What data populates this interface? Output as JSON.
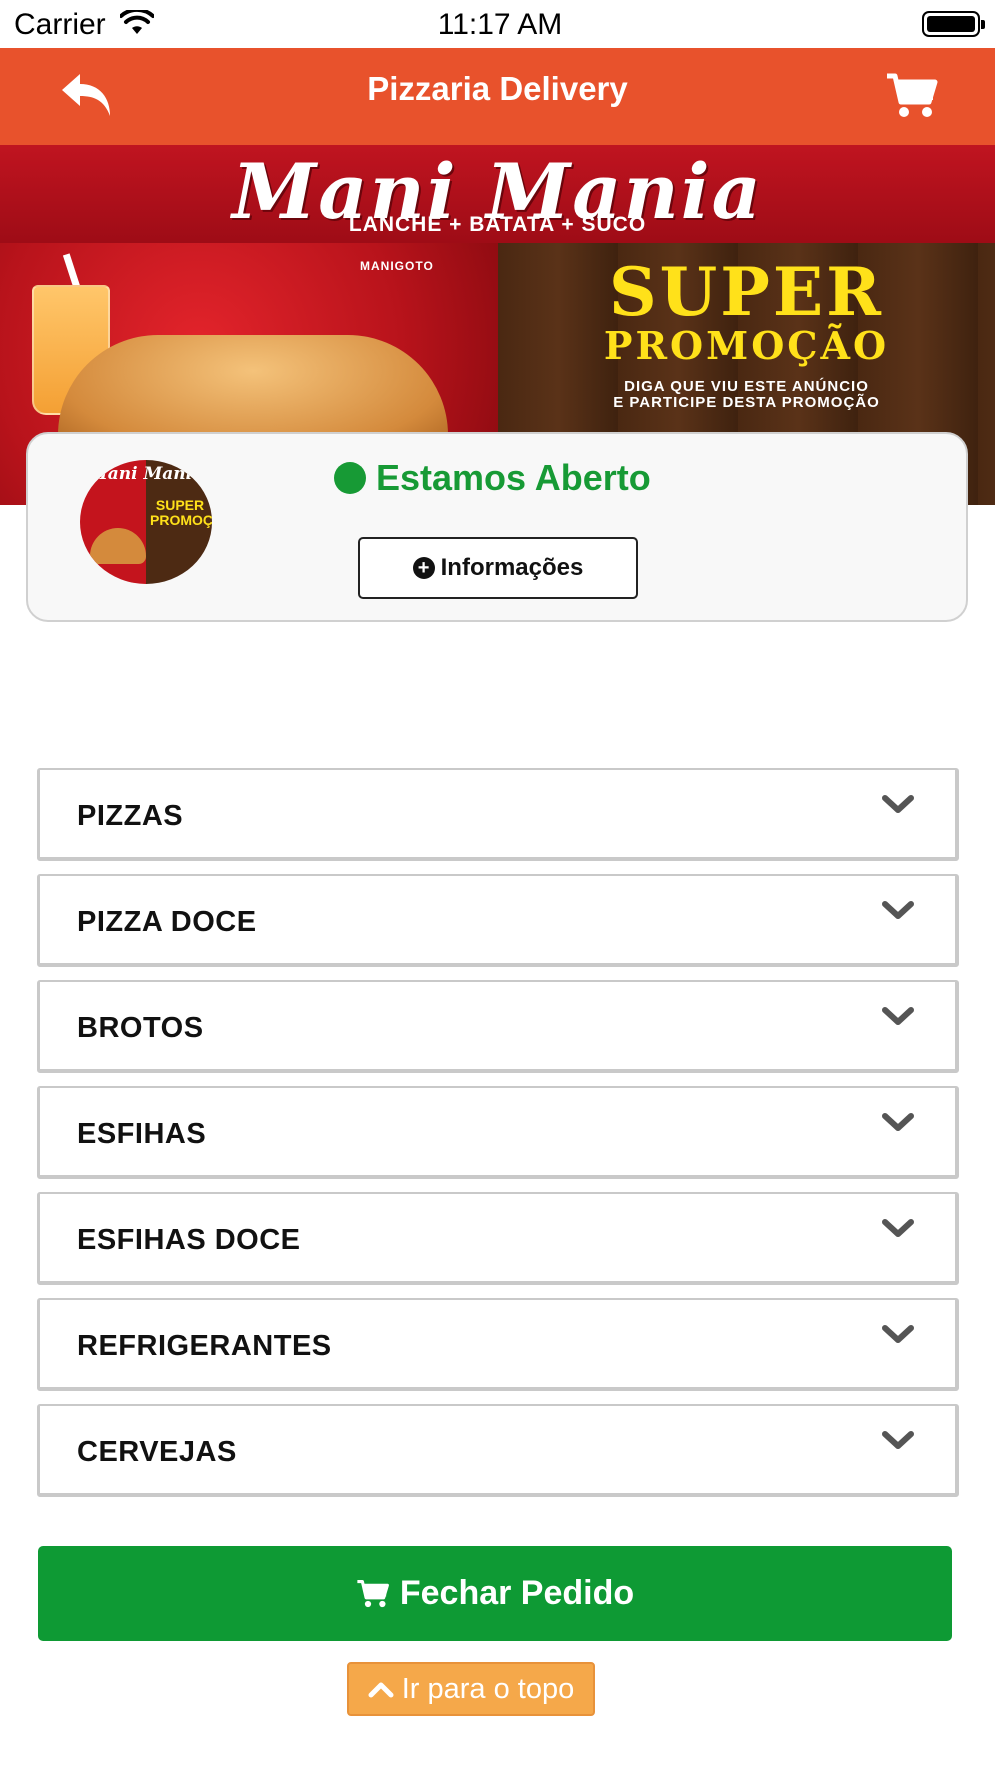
{
  "status_bar": {
    "carrier": "Carrier",
    "time": "11:17 AM"
  },
  "nav": {
    "title": "Pizzaria Delivery",
    "back_icon": "back-arrow-icon",
    "cart_icon": "cart-icon",
    "background_color": "#e8522c"
  },
  "banner": {
    "brand": "Mani Mania",
    "subtitle": "LANCHE + BATATA + SUCO",
    "maker": "MANIGOTO",
    "promo_line1": "SUPER",
    "promo_line2": "PROMOÇÃO",
    "promo_line3a": "DIGA QUE VIU ESTE ANÚNCIO",
    "promo_line3b": "E PARTICIPE DESTA PROMOÇÃO"
  },
  "store": {
    "logo_title": "Mani Mania",
    "logo_promo": "SUPER PROMOÇÃO",
    "status_text": "Estamos Aberto",
    "status_color": "#179a35",
    "info_button_label": "Informações"
  },
  "categories": [
    {
      "label": "PIZZAS"
    },
    {
      "label": "PIZZA DOCE"
    },
    {
      "label": "BROTOS"
    },
    {
      "label": "ESFIHAS"
    },
    {
      "label": "ESFIHAS DOCE"
    },
    {
      "label": "REFRIGERANTES"
    },
    {
      "label": "CERVEJAS"
    }
  ],
  "footer": {
    "checkout_label": "Fechar Pedido",
    "checkout_color": "#0e9a34",
    "top_label": "Ir para o topo",
    "top_color": "#f5a84a"
  }
}
